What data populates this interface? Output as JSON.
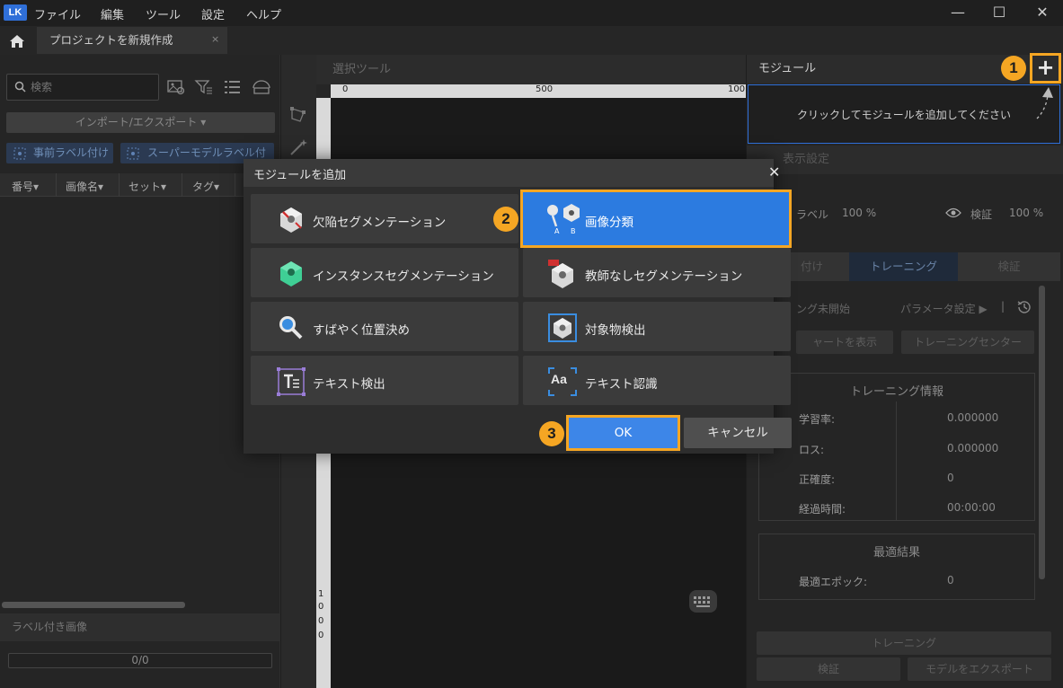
{
  "titlebar": {
    "logo": "LK",
    "menu": [
      "ファイル",
      "編集",
      "ツール",
      "設定",
      "ヘルプ"
    ],
    "window_buttons": {
      "minimize": "—",
      "maximize": "☐",
      "close": "✕"
    }
  },
  "tabs": {
    "project_tab": "プロジェクトを新規作成",
    "close": "×"
  },
  "left": {
    "search_placeholder": "検索",
    "import_export": "インポート/エクスポート ▾",
    "pre_label": "事前ラベル付け",
    "super_model_label": "スーパーモデルラベル付",
    "columns": [
      "番号▾",
      "画像名▾",
      "セット▾",
      "タグ▾"
    ],
    "labeled_images": "ラベル付き画像",
    "progress": "0/0"
  },
  "center": {
    "select_tool": "選択ツール",
    "ruler_top": [
      "0",
      "500",
      "100"
    ],
    "ruler_left": [
      "1",
      "0",
      "0",
      "0"
    ]
  },
  "right": {
    "module_title": "モジュール",
    "add_symbol": "+",
    "module_hint": "クリックしてモジュールを追加してください",
    "display_settings": "表示設定",
    "label_text": "ラベル",
    "label_pct": "100 %",
    "verify_text": "検証",
    "verify_pct": "100 %",
    "tabs": [
      "付け",
      "トレーニング",
      "検証"
    ],
    "status": "ング未開始",
    "param_settings": "パラメータ設定 ▶",
    "separator": "|",
    "show_chart": "ャートを表示",
    "training_center": "トレーニングセンター",
    "training_info_title": "トレーニング情報",
    "info_rows": [
      {
        "label": "学習率:",
        "value": "0.000000"
      },
      {
        "label": "ロス:",
        "value": "0.000000"
      },
      {
        "label": "正確度:",
        "value": "0"
      },
      {
        "label": "経過時間:",
        "value": "00:00:00"
      }
    ],
    "best_title": "最適結果",
    "best_epoch_label": "最適エポック:",
    "best_epoch_value": "0",
    "train_btn": "トレーニング",
    "verify_btn": "検証",
    "export_btn": "モデルをエクスポート"
  },
  "dialog": {
    "title": "モジュールを追加",
    "close": "✕",
    "modules": [
      {
        "label": "欠陥セグメンテーション",
        "icon": "defect-segmentation-icon"
      },
      {
        "label": "画像分類",
        "icon": "image-classification-icon",
        "selected": true,
        "icon_letters": [
          "A",
          "B"
        ]
      },
      {
        "label": "インスタンスセグメンテーション",
        "icon": "instance-segmentation-icon"
      },
      {
        "label": "教師なしセグメンテーション",
        "icon": "unsupervised-segmentation-icon"
      },
      {
        "label": "すばやく位置決め",
        "icon": "fast-positioning-icon"
      },
      {
        "label": "対象物検出",
        "icon": "object-detection-icon"
      },
      {
        "label": "テキスト検出",
        "icon": "text-detection-icon"
      },
      {
        "label": "テキスト認識",
        "icon": "text-recognition-icon",
        "icon_text": "Aa"
      }
    ],
    "ok": "OK",
    "cancel": "キャンセル"
  },
  "callouts": [
    "1",
    "2",
    "3"
  ],
  "colors": {
    "accent_orange": "#f5a623",
    "selected_blue": "#2c7be0",
    "ok_blue": "#3d86e8"
  }
}
